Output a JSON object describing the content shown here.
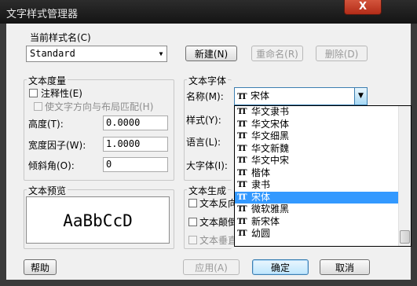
{
  "window": {
    "title": "文字样式管理器",
    "close_label": "X"
  },
  "current_style": {
    "label": "当前样式名(C)",
    "value": "Standard",
    "new_button": "新建(N)",
    "rename_button": "重命名(R)",
    "delete_button": "删除(D)"
  },
  "text_metrics": {
    "group_title": "文本度量",
    "annotative_label": "注释性(E)",
    "match_orientation_label": "使文字方向与布局匹配(H)",
    "height_label": "高度(T):",
    "height_value": "0.0000",
    "width_factor_label": "宽度因子(W):",
    "width_factor_value": "1.0000",
    "oblique_label": "倾斜角(O):",
    "oblique_value": "0"
  },
  "text_font": {
    "group_title": "文本字体",
    "name_label": "名称(M):",
    "name_value": "宋体",
    "style_label": "样式(Y):",
    "language_label": "语言(L):",
    "bigfont_label": "大字体(I):"
  },
  "font_dropdown": {
    "items": [
      "华文隶书",
      "华文宋体",
      "华文细黑",
      "华文新魏",
      "华文中宋",
      "楷体",
      "隶书",
      "宋体",
      "微软雅黑",
      "新宋体",
      "幼圆"
    ],
    "selected": "宋体",
    "icon_glyph": "TT"
  },
  "preview": {
    "group_title": "文本预览",
    "sample": "AaBbCcD"
  },
  "generation": {
    "group_title": "文本生成",
    "reverse_label": "文本反向",
    "upside_label": "文本颠倒",
    "vertical_label": "文本垂直"
  },
  "footer": {
    "help_button": "帮助",
    "apply_button": "应用(A)",
    "ok_button": "确定",
    "cancel_button": "取消"
  }
}
